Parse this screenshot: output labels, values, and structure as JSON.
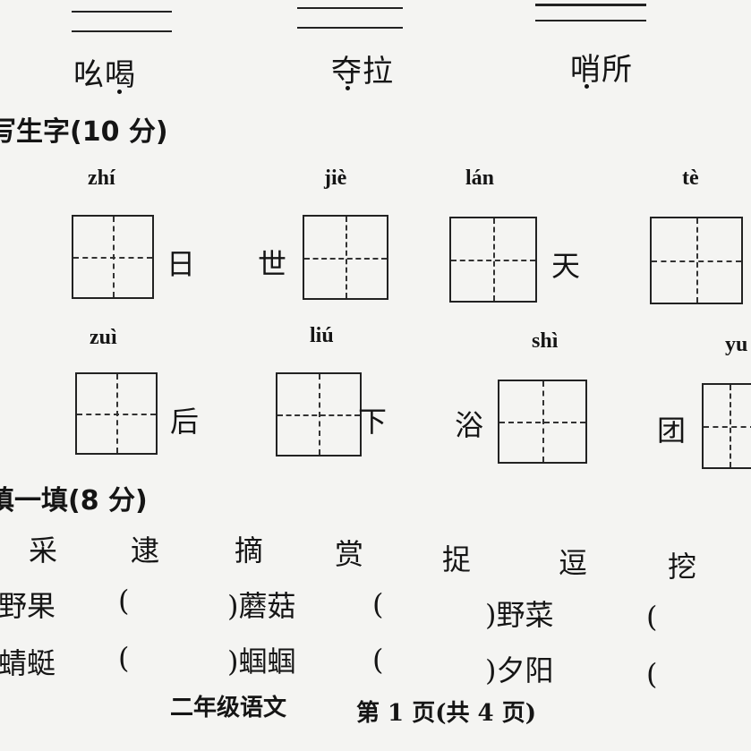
{
  "top_words": [
    "吆喝",
    "夺拉",
    "哨所"
  ],
  "section_2": {
    "title": "写生字(10 分)",
    "row1": [
      {
        "pinyin": "zhí",
        "char": "日"
      },
      {
        "pinyin": "jiè",
        "char": "世"
      },
      {
        "pinyin": "lán",
        "char": "天"
      },
      {
        "pinyin": "tè",
        "char": ""
      }
    ],
    "row2": [
      {
        "pinyin": "zuì",
        "char": "后"
      },
      {
        "pinyin": "liú",
        "char": "下"
      },
      {
        "pinyin": "shì",
        "char": "浴"
      },
      {
        "pinyin": "yu",
        "char": "团"
      }
    ]
  },
  "section_3": {
    "title": "填一填(8 分)",
    "word_bank": [
      "采",
      "逮",
      "摘",
      "赏",
      "捉",
      "逗",
      "挖"
    ],
    "rows": [
      {
        "first": "野果",
        "left_paren": "(",
        "right_paren_1": ")蘑菇",
        "mid_paren": "(",
        "right_paren_2": ")野菜",
        "end_paren": "("
      },
      {
        "first": "蜻蜓",
        "left_paren": "(",
        "right_paren_1": ")蝈蝈",
        "mid_paren": "(",
        "right_paren_2": ")夕阳",
        "end_paren": "("
      }
    ]
  },
  "footer": {
    "subject": "二年级语文",
    "page": "第 1 页(共 4 页)"
  }
}
